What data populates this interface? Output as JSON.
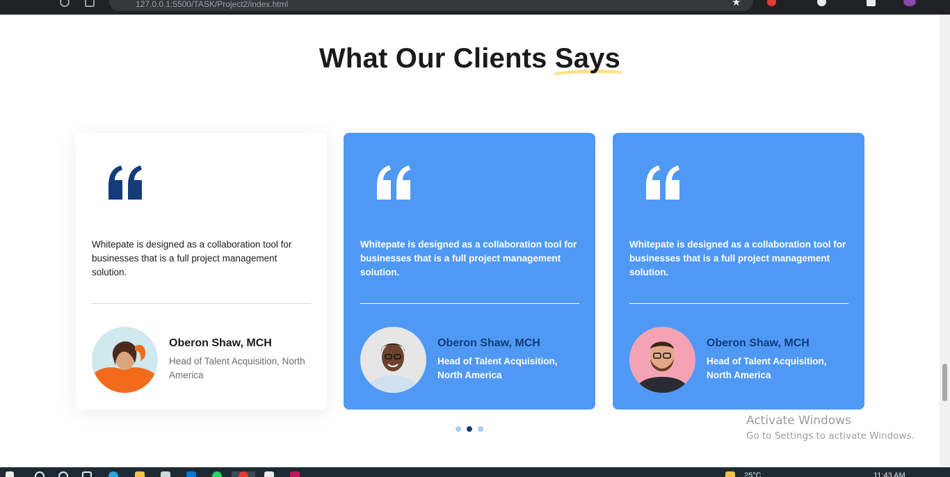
{
  "browser": {
    "url": "127.0.0.1:5500/TASK/Project2/index.html"
  },
  "section": {
    "title_main": "What Our Clients ",
    "title_highlight": "Says"
  },
  "testimonials": [
    {
      "text": "Whitepate is designed as a collaboration tool for businesses that is a full project management solution.",
      "name": "Oberon Shaw, MCH",
      "role": "Head of Talent Acquisition, North America",
      "style": "white"
    },
    {
      "text": "Whitepate is designed as a collaboration tool for businesses that is a full project management solution.",
      "name": "Oberon Shaw, MCH",
      "role": "Head of Talent Acquisition, North America",
      "style": "blue"
    },
    {
      "text": "Whitepate is designed as a collaboration tool for businesses that is a full project management solution.",
      "name": "Oberon Shaw, MCH",
      "role": "Head of Talent Acquisition, North America",
      "style": "blue"
    }
  ],
  "carousel": {
    "active_index": 1,
    "dot_count": 3
  },
  "watermark": {
    "line1": "Activate Windows",
    "line2": "Go to Settings to activate Windows."
  },
  "taskbar": {
    "weather": "25°C",
    "time": "11:43 AM"
  },
  "colors": {
    "accent_blue": "#4f99f4",
    "navy": "#143c78",
    "highlight_yellow": "#ffd75e"
  },
  "icons": {
    "quote": "quote-icon",
    "star": "star-icon"
  }
}
